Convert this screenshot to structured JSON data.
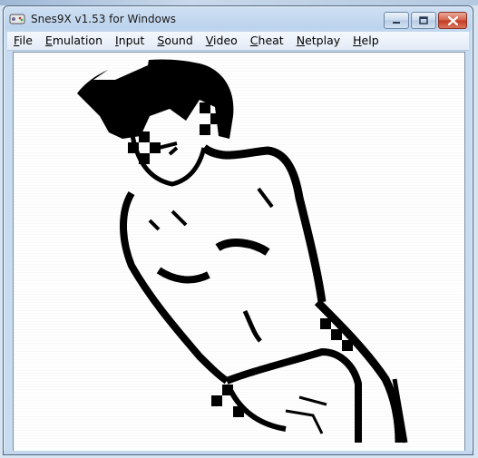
{
  "window": {
    "title": "Snes9X v1.53 for Windows",
    "icon": "snes9x-app-icon"
  },
  "titlebar_buttons": {
    "minimize_icon": "minimize-icon",
    "maximize_icon": "maximize-icon",
    "close_icon": "close-icon"
  },
  "menu": [
    {
      "label": "File",
      "accel": "F",
      "rest": "ile"
    },
    {
      "label": "Emulation",
      "accel": "E",
      "rest": "mulation"
    },
    {
      "label": "Input",
      "accel": "I",
      "rest": "nput"
    },
    {
      "label": "Sound",
      "accel": "S",
      "rest": "ound"
    },
    {
      "label": "Video",
      "accel": "V",
      "rest": "ideo"
    },
    {
      "label": "Cheat",
      "accel": "C",
      "rest": "heat"
    },
    {
      "label": "Netplay",
      "accel": "N",
      "rest": "etplay"
    },
    {
      "label": "Help",
      "accel": "H",
      "rest": "elp"
    }
  ],
  "colors": {
    "titlebar": "#c8dcf1",
    "close_button": "#c23a20",
    "screen_background": "#ffffff",
    "ink": "#000000"
  }
}
